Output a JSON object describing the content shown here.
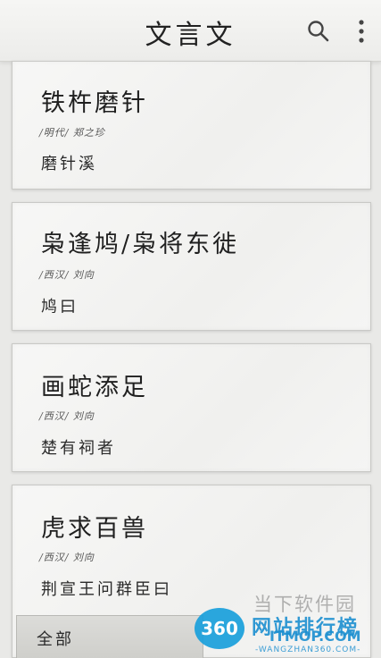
{
  "app_bar": {
    "title": "文言文",
    "search_icon": "search-icon",
    "more_icon": "more-vertical-icon"
  },
  "cards": [
    {
      "title": "铁杵磨针",
      "meta": "/明代/ 郑之珍",
      "excerpt": "磨针溪"
    },
    {
      "title": "枭逢鸠/枭将东徙",
      "meta": "/西汉/ 刘向",
      "excerpt": "鸠曰"
    },
    {
      "title": "画蛇添足",
      "meta": "/西汉/ 刘向",
      "excerpt": "楚有祠者"
    },
    {
      "title": "虎求百兽",
      "meta": "/西汉/ 刘向",
      "excerpt": "荆宣王问群臣曰"
    }
  ],
  "bottom_tab": {
    "label": "全部"
  },
  "watermark": {
    "top": "当下软件园",
    "badge": "360",
    "main": "网站排行榜",
    "itmop": "ITMOP.COM",
    "url": "-WANGZHAN360.COM-"
  }
}
